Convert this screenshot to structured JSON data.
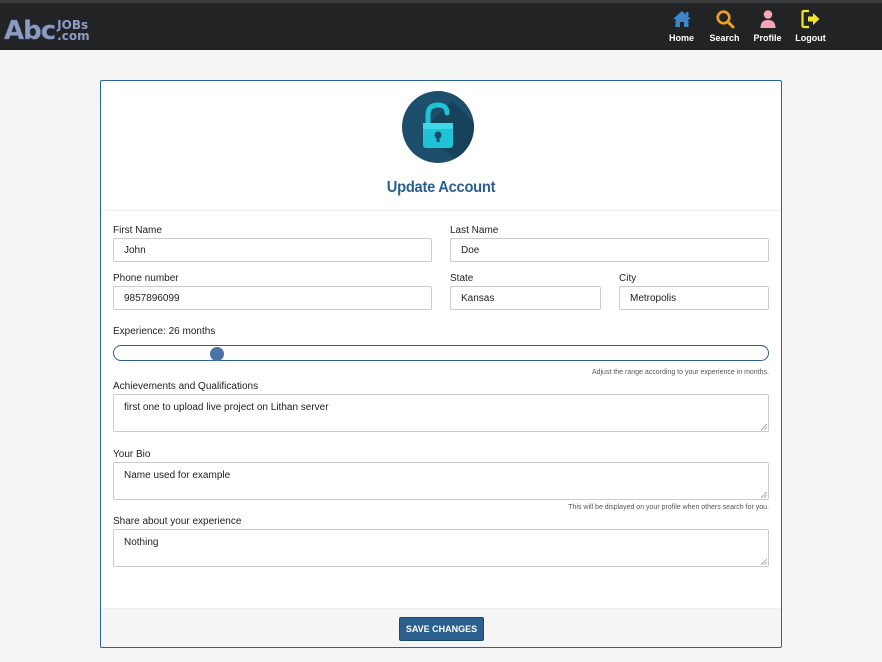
{
  "brand": {
    "logo_main": "Abc",
    "logo_top": "JOBs",
    "logo_bottom": ".com"
  },
  "nav": {
    "items": [
      {
        "label": "Home",
        "icon": "home-icon",
        "color": "#3f86c8"
      },
      {
        "label": "Search",
        "icon": "search-icon",
        "color": "#f0a020"
      },
      {
        "label": "Profile",
        "icon": "user-icon",
        "color": "#f4a6b6"
      },
      {
        "label": "Logout",
        "icon": "logout-icon",
        "color": "#f5e52a"
      }
    ]
  },
  "form": {
    "title": "Update Account",
    "first_name": {
      "label": "First Name",
      "value": "John"
    },
    "last_name": {
      "label": "Last Name",
      "value": "Doe"
    },
    "phone": {
      "label": "Phone number",
      "value": "9857896099"
    },
    "state": {
      "label": "State",
      "value": "Kansas"
    },
    "city": {
      "label": "City",
      "value": "Metropolis"
    },
    "experience": {
      "label": "Experience: 26 months",
      "value_fraction": 0.15,
      "hint": "Adjust the range according to your experience in months."
    },
    "achievements": {
      "label": "Achievements and Qualifications",
      "value": "first one to upload live project on Lithan server"
    },
    "bio": {
      "label": "Your Bio",
      "value": "Name used for example",
      "hint": "This will be displayed on your profile when others search for you."
    },
    "share_experience": {
      "label": "Share about your experience",
      "value": "Nothing"
    },
    "save_label": "SAVE CHANGES"
  },
  "colors": {
    "accent": "#2a5f8e",
    "navbar": "#222325",
    "lock_circle": "#1d4e6b",
    "lock_body": "#1fc3d6"
  }
}
